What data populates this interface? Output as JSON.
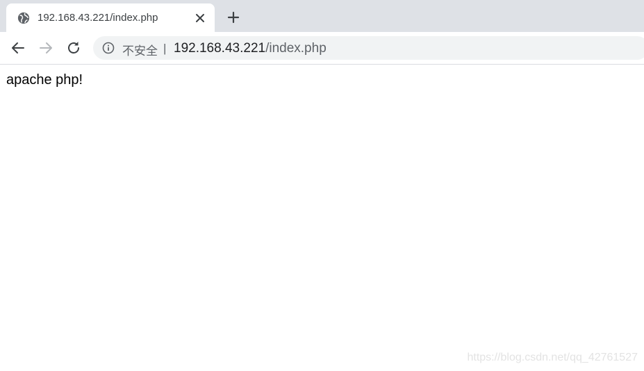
{
  "tab": {
    "title": "192.168.43.221/index.php",
    "favicon_icon": "globe-icon",
    "close_icon": "close-icon"
  },
  "new_tab_icon": "plus-icon",
  "toolbar": {
    "back_icon": "arrow-left-icon",
    "forward_icon": "arrow-right-icon",
    "reload_icon": "reload-icon",
    "forward_enabled": false
  },
  "omnibox": {
    "security_icon": "info-icon",
    "security_label": "不安全",
    "separator": "|",
    "url_host": "192.168.43.221",
    "url_path": "/index.php"
  },
  "page": {
    "body_text": "apache php!"
  },
  "watermark": "https://blog.csdn.net/qq_42761527",
  "colors": {
    "tabstrip": "#dee1e6",
    "omnibox": "#f1f3f4",
    "icon": "#5f6368",
    "icon_disabled": "#b4b7bb"
  }
}
